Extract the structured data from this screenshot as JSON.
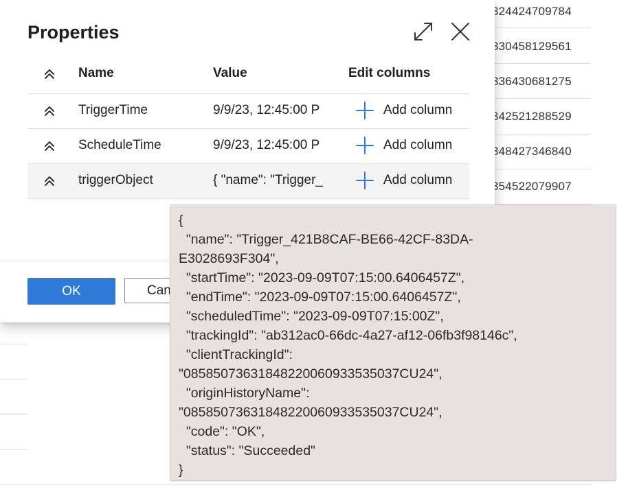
{
  "background_table": {
    "ids": [
      "324424709784",
      "330458129561",
      "336430681275",
      "342521288529",
      "348427346840",
      "354522079907"
    ]
  },
  "dialog": {
    "title": "Properties",
    "columns": {
      "name": "Name",
      "value": "Value",
      "edit": "Edit columns"
    },
    "rows": [
      {
        "name": "TriggerTime",
        "value": "9/9/23, 12:45:00 P",
        "action": "Add column"
      },
      {
        "name": "ScheduleTime",
        "value": "9/9/23, 12:45:00 P",
        "action": "Add column"
      },
      {
        "name": "triggerObject",
        "value": "{ \"name\": \"Trigger_",
        "action": "Add column"
      }
    ],
    "ok_label": "OK",
    "cancel_label": "Can"
  },
  "tooltip": {
    "text": "{\n  \"name\": \"Trigger_421B8CAF-BE66-42CF-83DA-\nE3028693F304\",\n  \"startTime\": \"2023-09-09T07:15:00.6406457Z\",\n  \"endTime\": \"2023-09-09T07:15:00.6406457Z\",\n  \"scheduledTime\": \"2023-09-09T07:15:00Z\",\n  \"trackingId\": \"ab312ac0-66dc-4a27-af12-06fb3f98146c\",\n  \"clientTrackingId\":\n\"08585073631848220060933535037CU24\",\n  \"originHistoryName\":\n\"08585073631848220060933535037CU24\",\n  \"code\": \"OK\",\n  \"status\": \"Succeeded\"\n}"
  },
  "colors": {
    "primary": "#2f7ad6",
    "tooltip_bg": "#e8e1df",
    "row_highlight": "#f3f3f3"
  }
}
